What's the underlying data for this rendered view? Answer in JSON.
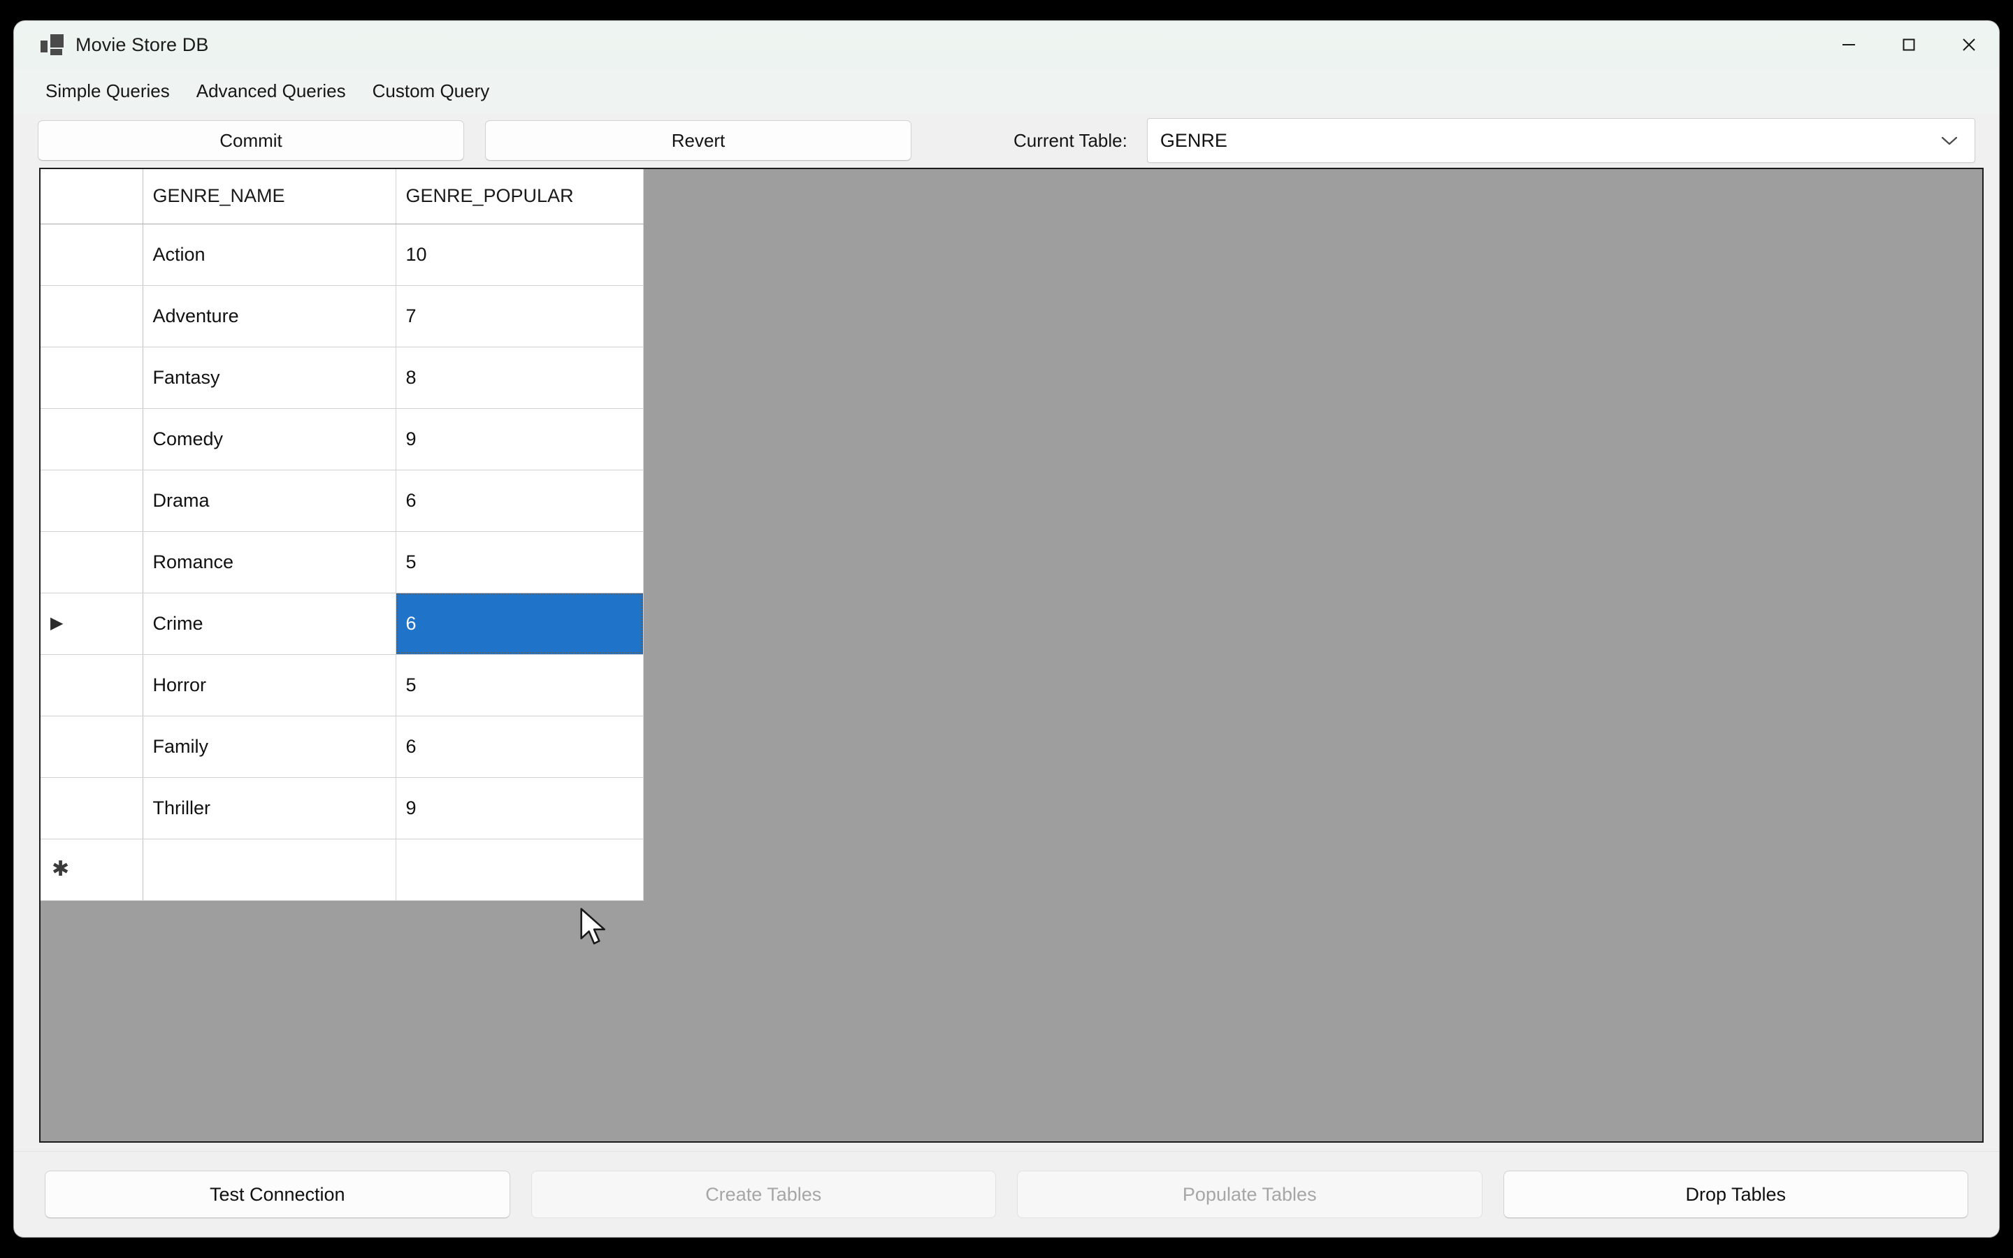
{
  "window": {
    "title": "Movie Store DB",
    "icon": "app-tiles-icon",
    "controls": {
      "minimize": "minimize-icon",
      "maximize": "maximize-icon",
      "close": "close-icon"
    }
  },
  "menubar": {
    "items": [
      {
        "label": "Simple Queries"
      },
      {
        "label": "Advanced Queries"
      },
      {
        "label": "Custom Query"
      }
    ]
  },
  "toolbar": {
    "commit_label": "Commit",
    "revert_label": "Revert",
    "current_table_label": "Current Table:",
    "current_table_value": "GENRE",
    "chevron_icon": "chevron-down-icon"
  },
  "grid": {
    "columns": [
      "GENRE_NAME",
      "GENRE_POPULAR"
    ],
    "rows": [
      {
        "marker": "",
        "genre_name": "Action",
        "genre_popularity": "10"
      },
      {
        "marker": "",
        "genre_name": "Adventure",
        "genre_popularity": "7"
      },
      {
        "marker": "",
        "genre_name": "Fantasy",
        "genre_popularity": "8"
      },
      {
        "marker": "",
        "genre_name": "Comedy",
        "genre_popularity": "9"
      },
      {
        "marker": "",
        "genre_name": "Drama",
        "genre_popularity": "6"
      },
      {
        "marker": "",
        "genre_name": "Romance",
        "genre_popularity": "5"
      },
      {
        "marker": "▶",
        "genre_name": "Crime",
        "genre_popularity": "6",
        "selected_cell": "genre_popularity"
      },
      {
        "marker": "",
        "genre_name": "Horror",
        "genre_popularity": "5"
      },
      {
        "marker": "",
        "genre_name": "Family",
        "genre_popularity": "6"
      },
      {
        "marker": "",
        "genre_name": "Thriller",
        "genre_popularity": "9"
      }
    ],
    "new_row": {
      "marker": "✱",
      "genre_name": "",
      "genre_popularity": ""
    },
    "selection_color": "#1f74c9",
    "background_color": "#9e9e9e"
  },
  "bottombar": {
    "buttons": [
      {
        "label": "Test Connection",
        "disabled": false
      },
      {
        "label": "Create Tables",
        "disabled": true
      },
      {
        "label": "Populate Tables",
        "disabled": true
      },
      {
        "label": "Drop Tables",
        "disabled": false
      }
    ]
  }
}
